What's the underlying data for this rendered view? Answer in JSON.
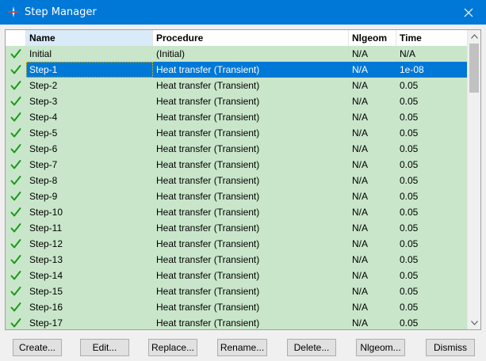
{
  "window": {
    "title": "Step Manager"
  },
  "columns": {
    "name": "Name",
    "procedure": "Procedure",
    "nlgeom": "Nlgeom",
    "time": "Time"
  },
  "selected_index": 1,
  "rows": [
    {
      "name": "Initial",
      "procedure": "(Initial)",
      "nlgeom": "N/A",
      "time": "N/A"
    },
    {
      "name": "Step-1",
      "procedure": "Heat transfer (Transient)",
      "nlgeom": "N/A",
      "time": "1e-08"
    },
    {
      "name": "Step-2",
      "procedure": "Heat transfer (Transient)",
      "nlgeom": "N/A",
      "time": "0.05"
    },
    {
      "name": "Step-3",
      "procedure": "Heat transfer (Transient)",
      "nlgeom": "N/A",
      "time": "0.05"
    },
    {
      "name": "Step-4",
      "procedure": "Heat transfer (Transient)",
      "nlgeom": "N/A",
      "time": "0.05"
    },
    {
      "name": "Step-5",
      "procedure": "Heat transfer (Transient)",
      "nlgeom": "N/A",
      "time": "0.05"
    },
    {
      "name": "Step-6",
      "procedure": "Heat transfer (Transient)",
      "nlgeom": "N/A",
      "time": "0.05"
    },
    {
      "name": "Step-7",
      "procedure": "Heat transfer (Transient)",
      "nlgeom": "N/A",
      "time": "0.05"
    },
    {
      "name": "Step-8",
      "procedure": "Heat transfer (Transient)",
      "nlgeom": "N/A",
      "time": "0.05"
    },
    {
      "name": "Step-9",
      "procedure": "Heat transfer (Transient)",
      "nlgeom": "N/A",
      "time": "0.05"
    },
    {
      "name": "Step-10",
      "procedure": "Heat transfer (Transient)",
      "nlgeom": "N/A",
      "time": "0.05"
    },
    {
      "name": "Step-11",
      "procedure": "Heat transfer (Transient)",
      "nlgeom": "N/A",
      "time": "0.05"
    },
    {
      "name": "Step-12",
      "procedure": "Heat transfer (Transient)",
      "nlgeom": "N/A",
      "time": "0.05"
    },
    {
      "name": "Step-13",
      "procedure": "Heat transfer (Transient)",
      "nlgeom": "N/A",
      "time": "0.05"
    },
    {
      "name": "Step-14",
      "procedure": "Heat transfer (Transient)",
      "nlgeom": "N/A",
      "time": "0.05"
    },
    {
      "name": "Step-15",
      "procedure": "Heat transfer (Transient)",
      "nlgeom": "N/A",
      "time": "0.05"
    },
    {
      "name": "Step-16",
      "procedure": "Heat transfer (Transient)",
      "nlgeom": "N/A",
      "time": "0.05"
    },
    {
      "name": "Step-17",
      "procedure": "Heat transfer (Transient)",
      "nlgeom": "N/A",
      "time": "0.05"
    }
  ],
  "buttons": {
    "create": "Create...",
    "edit": "Edit...",
    "replace": "Replace...",
    "rename": "Rename...",
    "delete": "Delete...",
    "nlgeom": "Nlgeom...",
    "dismiss": "Dismiss"
  },
  "colors": {
    "title_bar": "#0078d7",
    "row_bg": "#c9e6ca",
    "selection": "#0078d7",
    "check": "#1a9a1a"
  },
  "icons": {
    "app": "abaqus-app-icon",
    "close": "close-icon",
    "row_status": "checkmark-icon"
  }
}
